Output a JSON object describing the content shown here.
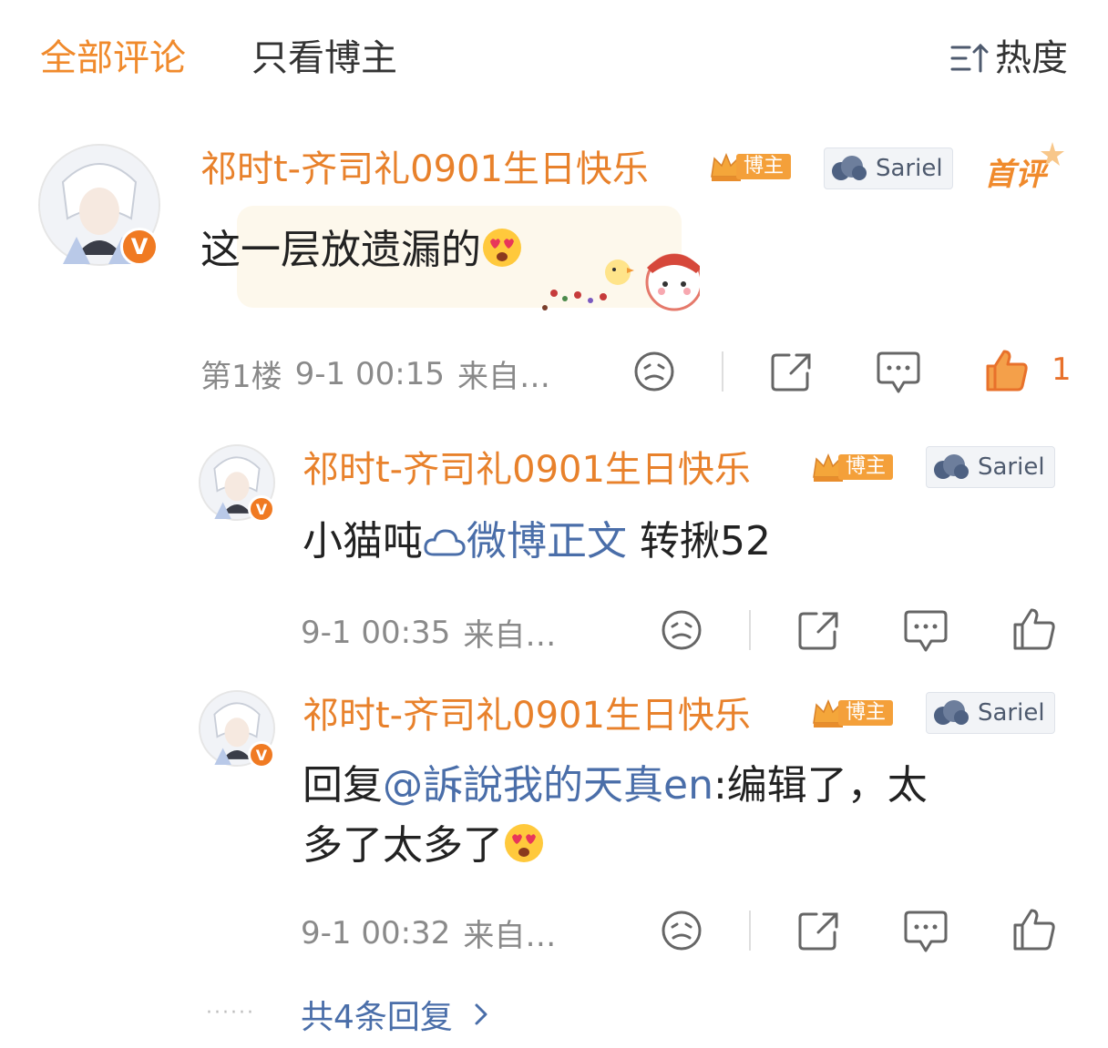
{
  "tabs": {
    "all_comments": "全部评论",
    "author_only": "只看博主",
    "sort_label": "热度"
  },
  "colors": {
    "accent_orange": "#f08a2c",
    "link_blue": "#4a6ea9",
    "meta_gray": "#8a8a8a"
  },
  "main_comment": {
    "username": "祁时t-齐司礼0901生日快乐",
    "host_tag": "博主",
    "fan_tag": "Sariel",
    "first_review": "首评",
    "text": "这一层放遗漏的",
    "floor": "第1楼",
    "time": "9-1 00:15",
    "source": "来自…",
    "like_count": "1"
  },
  "replies": [
    {
      "username": "祁时t-齐司礼0901生日快乐",
      "host_tag": "博主",
      "fan_tag": "Sariel",
      "text_prefix": "小猫吨",
      "link_text": "微博正文",
      "text_suffix": " 转揪52",
      "time": "9-1 00:35",
      "source": "来自…"
    },
    {
      "username": "祁时t-齐司礼0901生日快乐",
      "host_tag": "博主",
      "fan_tag": "Sariel",
      "text_prefix": "回复",
      "mention": "@訴說我的天真en",
      "text_suffix": ":编辑了，太",
      "text_line2": "多了太多了",
      "time": "9-1 00:32",
      "source": "来自…"
    }
  ],
  "more_replies": "共4条回复",
  "icons": [
    "sort-icon",
    "dislike-icon",
    "share-icon",
    "comment-icon",
    "like-icon",
    "chevron-right-icon"
  ]
}
